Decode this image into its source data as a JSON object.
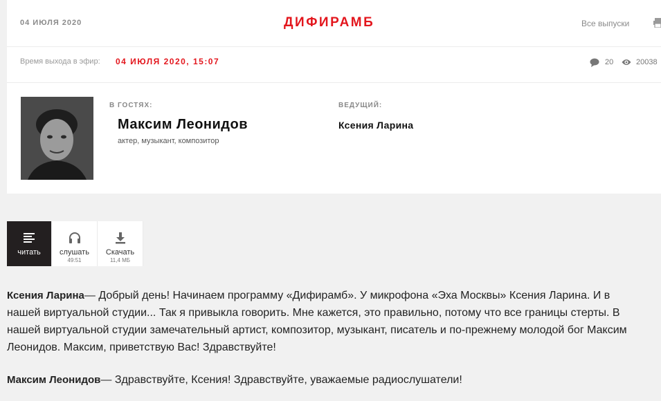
{
  "header": {
    "date": "04 ИЮЛЯ 2020",
    "program_title": "ДИФИРАМБ",
    "all_issues": "Все выпуски"
  },
  "broadcast": {
    "air_label": "Время выхода в эфир:",
    "air_datetime": "04 ИЮЛЯ 2020, 15:07",
    "comments": "20",
    "views": "20038"
  },
  "guests": {
    "label": "В ГОСТЯХ:",
    "name": "Максим Леонидов",
    "description": "актер, музыкант, композитор"
  },
  "host": {
    "label": "ВЕДУЩИЙ:",
    "name": "Ксения Ларина"
  },
  "tabs": [
    {
      "label": "читать",
      "sub": "",
      "icon": "text-lines-icon"
    },
    {
      "label": "слушать",
      "sub": "49:51",
      "icon": "headphones-icon"
    },
    {
      "label": "Скачать",
      "sub": "11,4 МБ",
      "icon": "download-icon"
    }
  ],
  "transcript": [
    {
      "speaker": "Ксения Ларина",
      "text": "— Добрый день! Начинаем программу «Дифирамб». У микрофона «Эха Москвы» Ксения Ларина. И в нашей виртуальной студии... Так я привыкла говорить. Мне кажется, это правильно, потому что все границы стерты. В нашей виртуальной студии замечательный артист, композитор, музыкант, писатель и по-прежнему молодой бог Максим Леонидов. Максим, приветствую Вас! Здравствуйте!"
    },
    {
      "speaker": "Максим Леонидов",
      "text": "— Здравствуйте, Ксения! Здравствуйте, уважаемые радиослушатели!"
    }
  ],
  "colors": {
    "accent": "#e3161d",
    "active_tab": "#231f20",
    "page_background": "#f1f1f1"
  }
}
